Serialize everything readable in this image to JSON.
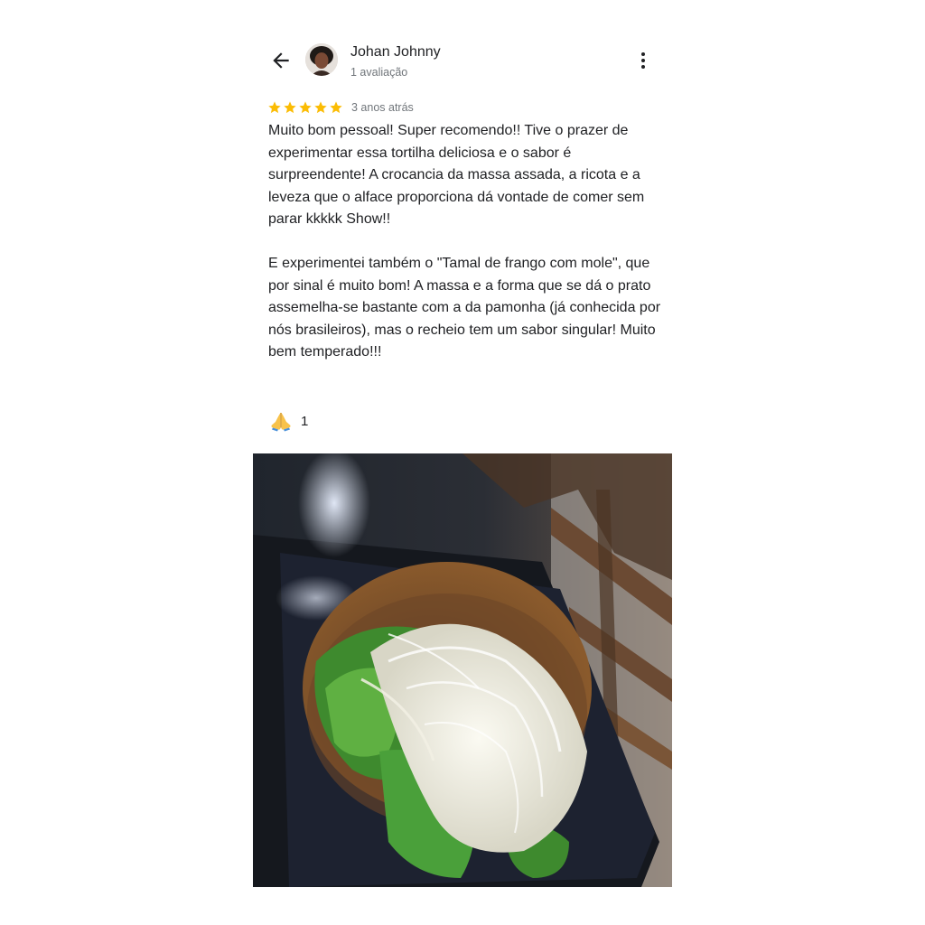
{
  "header": {
    "reviewer_name": "Johan Johnny",
    "review_count": "1 avaliação"
  },
  "review": {
    "rating": 5,
    "age": "3 anos atrás",
    "paragraphs": [
      "Muito bom pessoal! Super recomendo!! Tive o prazer de experimentar essa tortilha deliciosa e o sabor é surpreendente! A crocancia da massa assada, a ricota e a leveza que o alface proporciona dá vontade de comer sem parar kkkkk Show!!",
      "E experimentei também o \"Tamal de frango com mole\", que por sinal é muito bom! A massa e a forma que se dá o prato assemelha-se bastante com a da pamonha (já conhecida por nós brasileiros), mas o recheio tem um sabor singular! Muito bem temperado!!!"
    ]
  },
  "reaction": {
    "icon": "folded-hands-emoji",
    "count": "1"
  },
  "icons": {
    "back": "arrow-back-icon",
    "menu": "more-vert-icon",
    "star": "star-icon"
  },
  "colors": {
    "star": "#fbbc04",
    "secondary_text": "#70757a",
    "primary_text": "#202124"
  }
}
